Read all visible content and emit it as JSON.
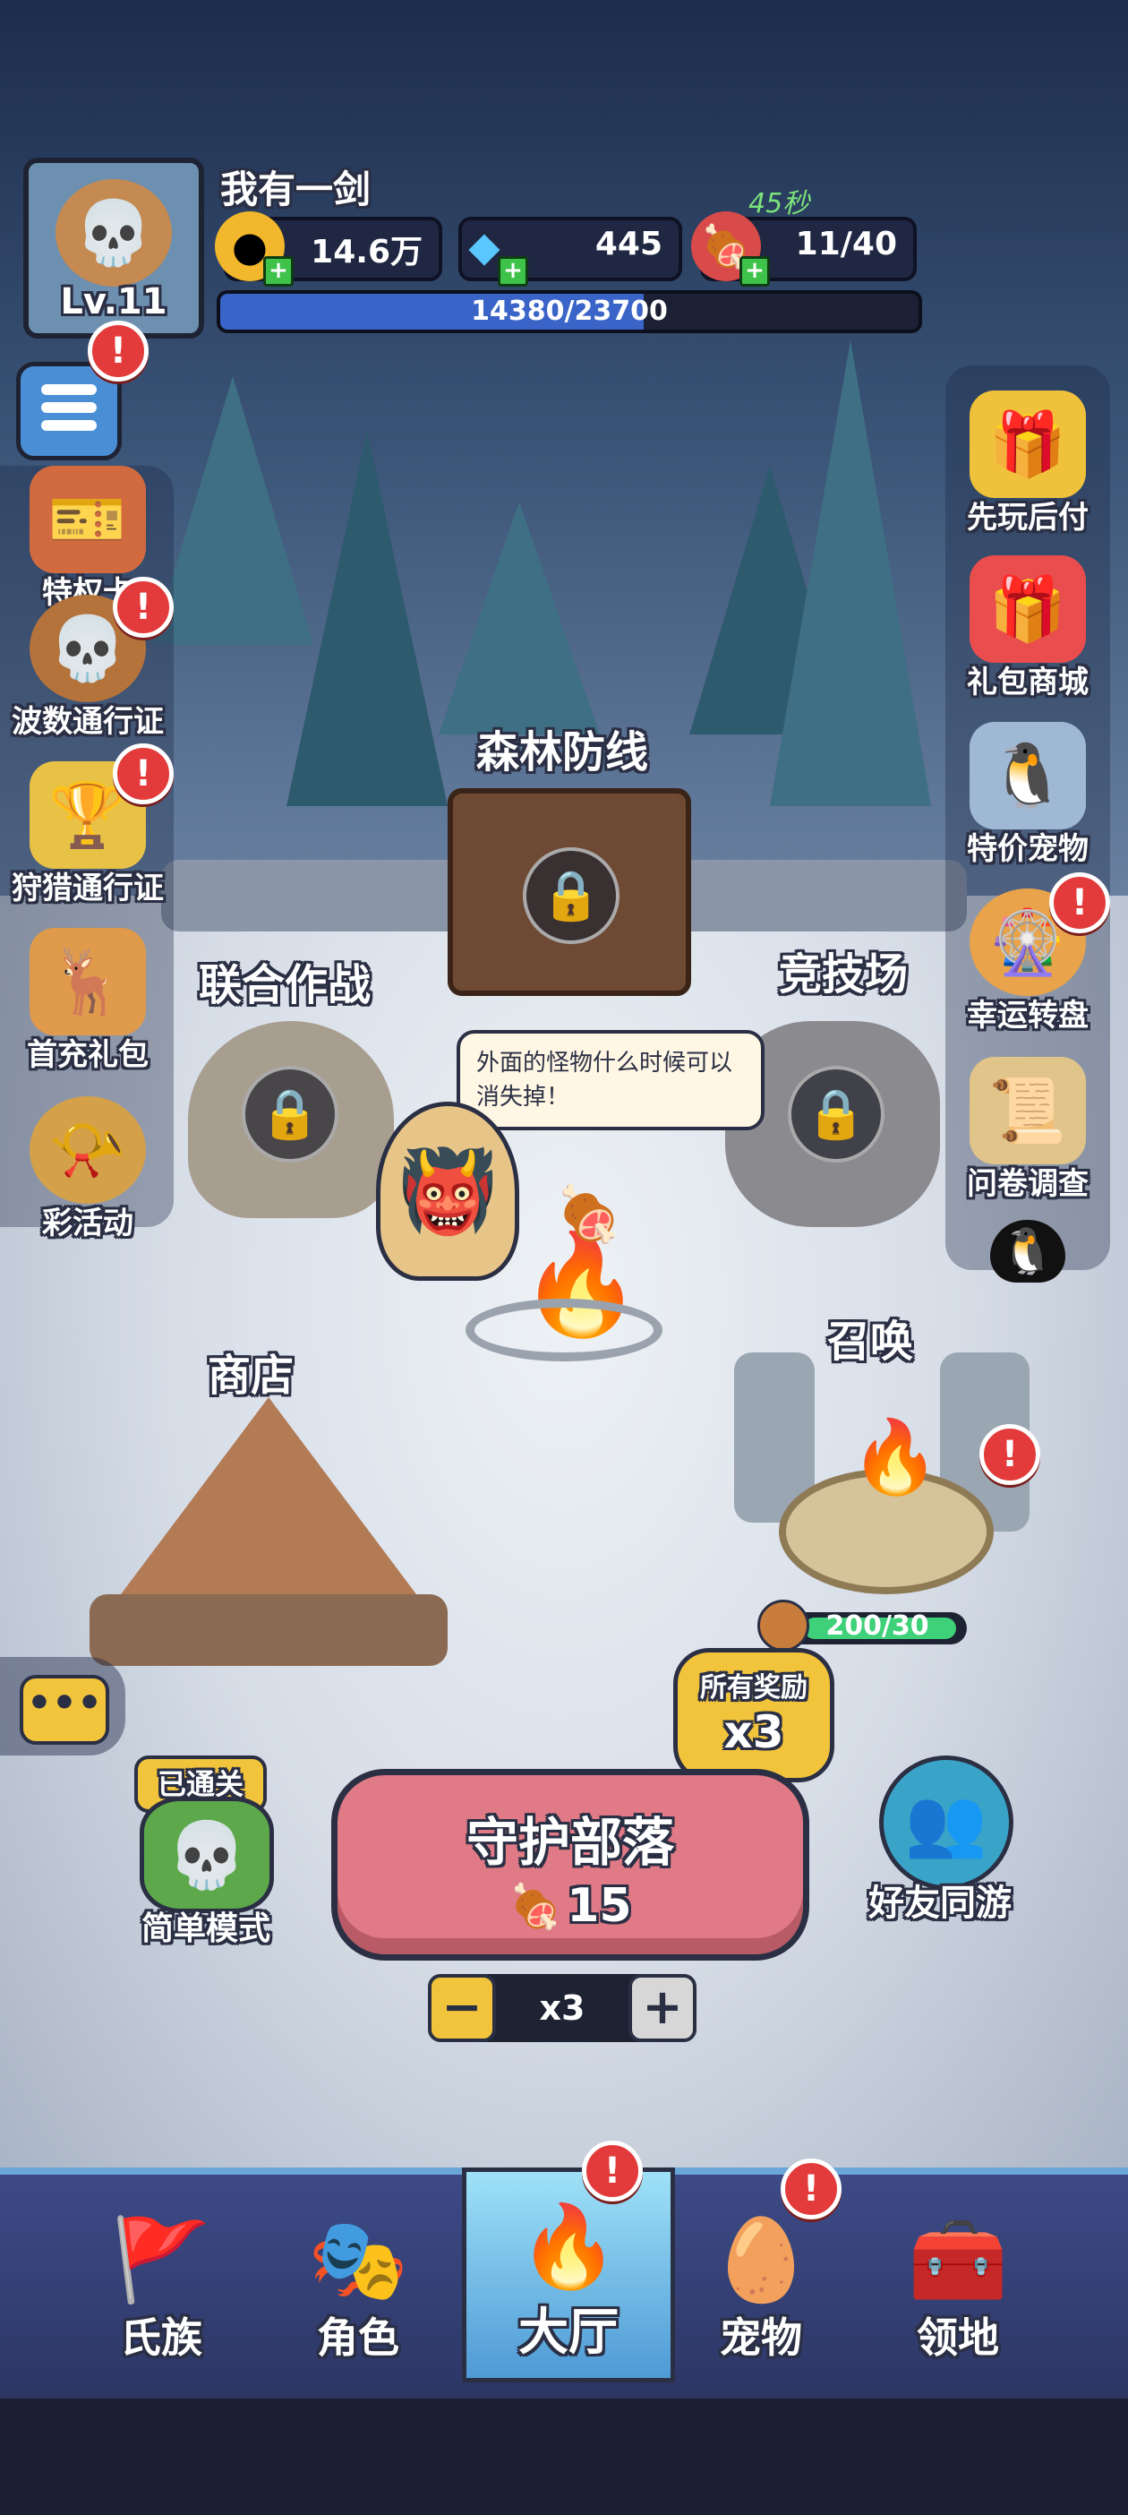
{
  "player": {
    "name": "我有一剑",
    "level": "Lv.11",
    "exp_text": "14380/23700",
    "exp_progress": 0.607
  },
  "resources": {
    "gold": "14.6万",
    "diamond": "445",
    "stamina": "11/40",
    "stamina_timer": "45秒"
  },
  "left_menu": {
    "items": [
      {
        "label": "特权卡",
        "icon": "privilege-card-icon"
      },
      {
        "label": "波数通行证",
        "icon": "wave-pass-icon",
        "badge": "!"
      },
      {
        "label": "狩猎通行证",
        "icon": "hunt-pass-icon",
        "badge": "!"
      },
      {
        "label": "首充礼包",
        "icon": "first-recharge-icon"
      },
      {
        "label": "彩活动",
        "icon": "event-horn-icon"
      }
    ],
    "menu_badge": "!"
  },
  "right_menu": {
    "items": [
      {
        "label": "先玩后付",
        "icon": "treasure-chest-icon"
      },
      {
        "label": "礼包商城",
        "icon": "gift-box-icon"
      },
      {
        "label": "特价宠物",
        "icon": "pet-deal-icon"
      },
      {
        "label": "幸运转盘",
        "icon": "lucky-wheel-icon",
        "badge": "!"
      },
      {
        "label": "问卷调查",
        "icon": "survey-scroll-icon"
      }
    ]
  },
  "map": {
    "forest_defense": "森林防线",
    "joint_battle": "联合作战",
    "arena": "竞技场",
    "summon": "召唤",
    "shop": "商店",
    "speech": "外面的怪物什么时候可以消失掉！",
    "summon_counter": "200/30",
    "summon_badge": "!"
  },
  "main_action": {
    "all_rewards_label": "所有奖励",
    "multiplier": "x3",
    "button_label": "守护部落",
    "cost": "15",
    "stepper_value": "x3",
    "minus": "−",
    "plus": "+"
  },
  "mode": {
    "cleared_tag": "已通关",
    "label": "简单模式"
  },
  "friends": {
    "label": "好友同游"
  },
  "bottom_nav": [
    {
      "label": "氏族",
      "icon": "clan-banner-icon"
    },
    {
      "label": "角色",
      "icon": "hero-mask-icon"
    },
    {
      "label": "大厅",
      "icon": "campfire-icon",
      "active": true,
      "badge": "!"
    },
    {
      "label": "宠物",
      "icon": "pet-egg-icon",
      "badge": "!"
    },
    {
      "label": "领地",
      "icon": "territory-chest-icon"
    }
  ],
  "colors": {
    "accent_red": "#e33b3b",
    "button_pink": "#e07a86",
    "exp_blue": "#3a64c8",
    "nav_bg": "#3d4a86",
    "nav_active": "#8fd3f0"
  }
}
